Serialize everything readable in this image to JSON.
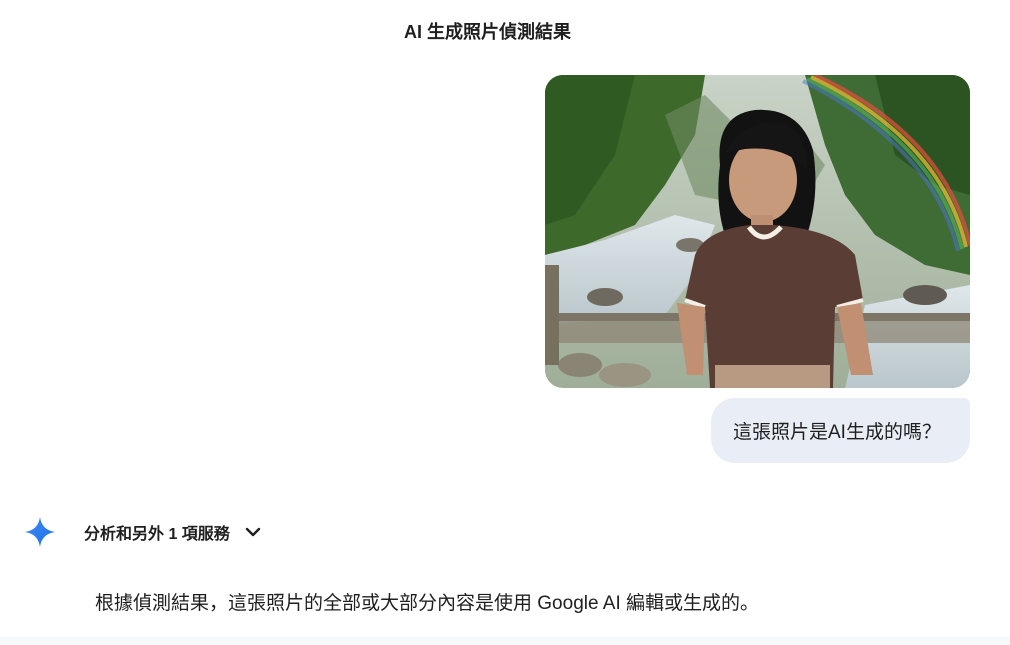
{
  "header": {
    "title": "AI 生成照片偵測結果"
  },
  "conversation": {
    "user_message": "這張照片是AI生成的嗎？",
    "image": {
      "description_icon": "photo"
    },
    "model": {
      "icon": "gemini-spark-icon",
      "tools_label": "分析和另外 1 項服務",
      "answer": "根據偵測結果，這張照片的全部或大部分內容是使用 Google AI 編輯或生成的。"
    }
  },
  "colors": {
    "bubble_bg": "#e9eef6",
    "spark_blue": "#4285f4",
    "text": "#1f1f1f"
  }
}
